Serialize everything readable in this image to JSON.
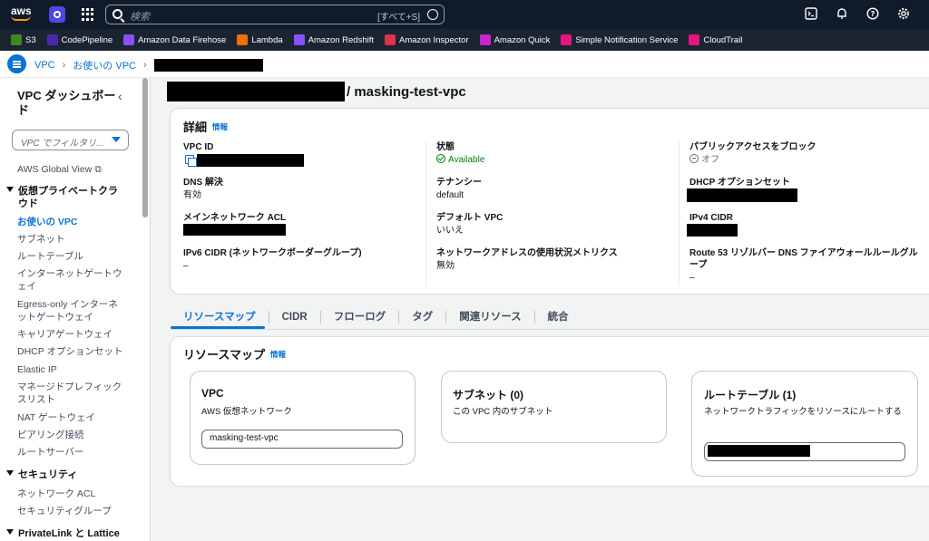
{
  "topbar": {
    "logo_text": "aws",
    "search_placeholder": "検索",
    "search_shortcut": "[すべて+S]"
  },
  "favorites": [
    {
      "label": "S3",
      "icon": "s3-icon",
      "color": "#3f8624"
    },
    {
      "label": "CodePipeline",
      "icon": "codepipeline-icon",
      "color": "#4d27aa"
    },
    {
      "label": "Amazon Data Firehose",
      "icon": "firehose-icon",
      "color": "#8c4fff"
    },
    {
      "label": "Lambda",
      "icon": "lambda-icon",
      "color": "#ed7100"
    },
    {
      "label": "Amazon Redshift",
      "icon": "redshift-icon",
      "color": "#8c4fff"
    },
    {
      "label": "Amazon Inspector",
      "icon": "inspector-icon",
      "color": "#dd344c"
    },
    {
      "label": "Amazon Quick",
      "icon": "quick-icon",
      "color": "#c925d1"
    },
    {
      "label": "Simple Notification Service",
      "icon": "sns-icon",
      "color": "#e7157b"
    },
    {
      "label": "CloudTrail",
      "icon": "cloudtrail-icon",
      "color": "#e7157b"
    }
  ],
  "breadcrumb": {
    "items": [
      "VPC",
      "お使いの VPC"
    ]
  },
  "sidebar": {
    "title": "VPC ダッシュボード",
    "filter_placeholder": "VPC でフィルタリ...",
    "global_view": "AWS Global View",
    "section_vpc": "仮想プライベートクラウド",
    "vpc_items": [
      "お使いの VPC",
      "サブネット",
      "ルートテーブル",
      "インターネットゲートウェイ",
      "Egress-only インターネットゲートウェイ",
      "キャリアゲートウェイ",
      "DHCP オプションセット",
      "Elastic IP",
      "マネージドプレフィックスリスト",
      "NAT ゲートウェイ",
      "ピアリング接続",
      "ルートサーバー"
    ],
    "section_security": "セキュリティ",
    "security_items": [
      "ネットワーク ACL",
      "セキュリティグループ"
    ],
    "section_privatelink": "PrivateLink と Lattice"
  },
  "page": {
    "title_suffix": "/ masking-test-vpc"
  },
  "details": {
    "heading": "詳細",
    "info": "情報",
    "vpc_id_label": "VPC ID",
    "dns_label": "DNS 解決",
    "dns_value": "有効",
    "main_acl_label": "メインネットワーク ACL",
    "ipv6_label": "IPv6 CIDR (ネットワークボーダーグループ)",
    "ipv6_value": "–",
    "state_label": "状態",
    "state_value": "Available",
    "tenancy_label": "テナンシー",
    "tenancy_value": "default",
    "default_vpc_label": "デフォルト VPC",
    "default_vpc_value": "いいえ",
    "metrics_label": "ネットワークアドレスの使用状況メトリクス",
    "metrics_value": "無効",
    "block_label": "パブリックアクセスをブロック",
    "block_value": "オフ",
    "dhcp_label": "DHCP オプションセット",
    "ipv4_label": "IPv4 CIDR",
    "route53_label": "Route 53 リゾルバー DNS ファイアウォールルールグループ",
    "route53_value": "–"
  },
  "tabs": [
    "リソースマップ",
    "CIDR",
    "フローログ",
    "タグ",
    "関連リソース",
    "統合"
  ],
  "resource_map": {
    "heading": "リソースマップ",
    "info": "情報",
    "vpc_title": "VPC",
    "vpc_desc": "AWS 仮想ネットワーク",
    "vpc_name": "masking-test-vpc",
    "subnet_title": "サブネット (0)",
    "subnet_desc": "この VPC 内のサブネット",
    "rt_title": "ルートテーブル (1)",
    "rt_desc": "ネットワークトラフィックをリソースにルートする"
  }
}
